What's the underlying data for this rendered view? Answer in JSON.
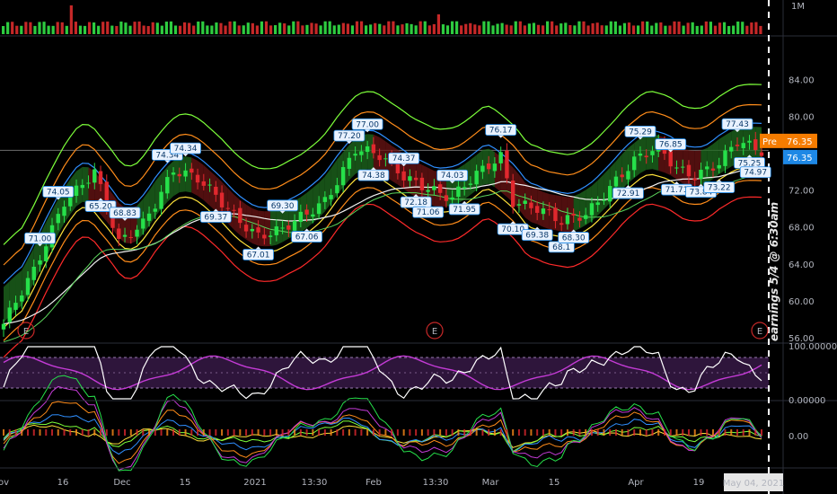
{
  "chart_data": {
    "type": "candlestick",
    "symbol_note": "earnings 5/4 @ 6:30am",
    "price_axis": {
      "ticks": [
        "56.00",
        "60.00",
        "64.00",
        "68.00",
        "72.00",
        "76.00",
        "80.00",
        "84.00"
      ],
      "ylim": [
        52.5,
        88.5
      ]
    },
    "volume_axis": {
      "label": "1M"
    },
    "pre_market": {
      "label": "Pre",
      "value": "76.35"
    },
    "last_price": "76.35",
    "reference_level": 76.3,
    "time_axis": [
      "ov",
      "16",
      "Dec",
      "15",
      "2021",
      "13:30",
      "Feb",
      "13:30",
      "Mar",
      "15",
      "Apr",
      "19"
    ],
    "cursor_date": "May 04, 2021",
    "earnings_markers": [
      "E",
      "E",
      "E"
    ],
    "callouts": [
      {
        "text": "71.00",
        "dir": "up"
      },
      {
        "text": "74.05",
        "dir": "up"
      },
      {
        "text": "65.20",
        "dir": "down"
      },
      {
        "text": "68.83",
        "dir": "up"
      },
      {
        "text": "74.34",
        "dir": "up"
      },
      {
        "text": "74.34",
        "dir": "up"
      },
      {
        "text": "69.37",
        "dir": "down"
      },
      {
        "text": "67.01",
        "dir": "down"
      },
      {
        "text": "69.30",
        "dir": "up"
      },
      {
        "text": "67.06",
        "dir": "down"
      },
      {
        "text": "77.20",
        "dir": "up"
      },
      {
        "text": "77.00",
        "dir": "up"
      },
      {
        "text": "74.38",
        "dir": "down"
      },
      {
        "text": "74.37",
        "dir": "up"
      },
      {
        "text": "72.18",
        "dir": "down"
      },
      {
        "text": "71.06",
        "dir": "down"
      },
      {
        "text": "74.03",
        "dir": "up"
      },
      {
        "text": "71.95",
        "dir": "down"
      },
      {
        "text": "76.17",
        "dir": "up"
      },
      {
        "text": "70.10",
        "dir": "down"
      },
      {
        "text": "69.38",
        "dir": "down"
      },
      {
        "text": "68.1",
        "dir": "down"
      },
      {
        "text": "68.30",
        "dir": "down"
      },
      {
        "text": "72.91",
        "dir": "down"
      },
      {
        "text": "75.29",
        "dir": "up"
      },
      {
        "text": "76.85",
        "dir": "up"
      },
      {
        "text": "71.71",
        "dir": "down"
      },
      {
        "text": "73.84",
        "dir": "down"
      },
      {
        "text": "73.22",
        "dir": "down"
      },
      {
        "text": "77.43",
        "dir": "up"
      },
      {
        "text": "75.25",
        "dir": "down"
      },
      {
        "text": "74.97",
        "dir": "down"
      }
    ],
    "oscillator_axis": [
      "100.00000",
      "0.00000"
    ],
    "macd_axis": [
      "0.00"
    ],
    "colors": {
      "up": "#26e04a",
      "down": "#e0282e",
      "volume_up": "#2ecc40",
      "volume_down": "#c62828",
      "band_outer": "#7cff3a",
      "band_orange": "#ff8c1a",
      "band_blue": "#2f8fff",
      "band_yellow": "#ffe23a",
      "band_red": "#ff2a2a",
      "ma_white": "#f2f2f2",
      "ma_green": "#5bd35b",
      "osc_white": "#ffffff",
      "osc_purple": "#c43bd6",
      "pre": "#f57c00",
      "last": "#1e88e5"
    }
  }
}
